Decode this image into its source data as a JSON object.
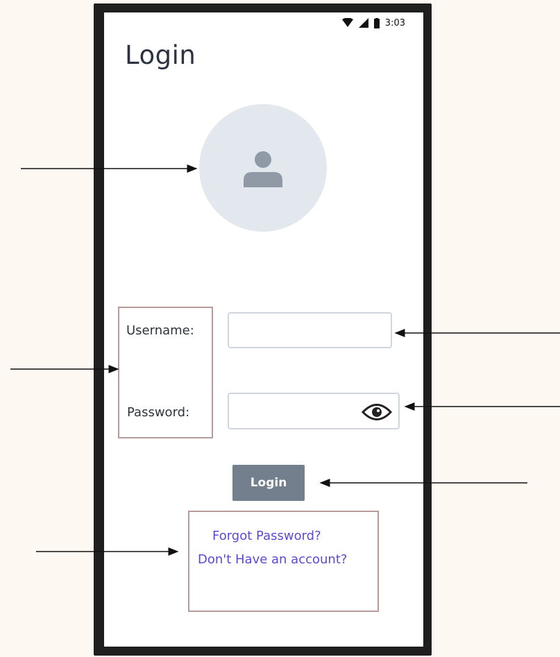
{
  "status_bar": {
    "time": "3:03"
  },
  "page": {
    "title": "Login"
  },
  "form": {
    "username_label": "Username:",
    "password_label": "Password:",
    "username_value": "",
    "password_value": ""
  },
  "actions": {
    "login_label": "Login",
    "forgot_password_label": "Forgot Password?",
    "no_account_label": "Don't Have an account?"
  },
  "colors": {
    "background": "#fdf8f2",
    "phone_frame": "#1f1f1f",
    "avatar_bg": "#e3e8ef",
    "avatar_icon": "#8f9aa6",
    "login_button": "#737f8d",
    "link": "#5b48d6",
    "annotation_box": "#b79b9b"
  },
  "icons": [
    "wifi-icon",
    "signal-icon",
    "battery-icon",
    "user-avatar-icon",
    "eye-icon"
  ]
}
